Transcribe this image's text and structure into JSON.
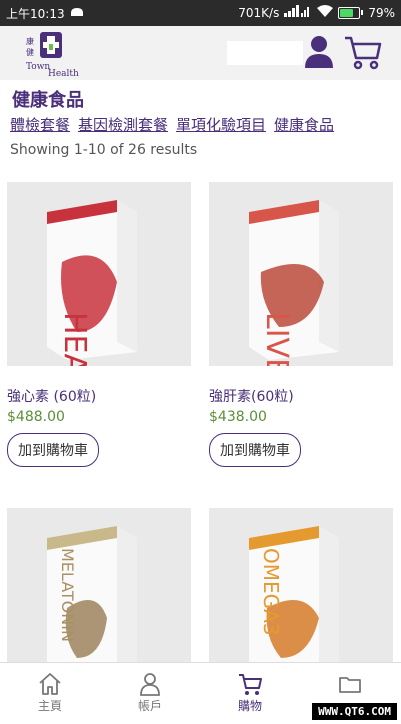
{
  "status_bar": {
    "time": "上午10:13",
    "network_speed": "701K/s",
    "battery_percent": "79%",
    "battery_level": 0.79
  },
  "header": {
    "logo_text_cn": "康健",
    "logo_text_en1": "Town",
    "logo_text_en2": "Health",
    "search_placeholder": ""
  },
  "page": {
    "title": "健康食品",
    "categories": [
      "體檢套餐",
      "基因檢測套餐",
      "單項化驗項目",
      "健康食品"
    ],
    "results_text": "Showing 1-10 of 26 results"
  },
  "products": [
    {
      "name": "強心素 (60粒)",
      "price": "$488.00",
      "button": "加到購物車",
      "box_text": "HEART",
      "color": "#c8323c"
    },
    {
      "name": "強肝素(60粒)",
      "price": "$438.00",
      "button": "加到購物車",
      "box_text": "LIVER",
      "color": "#d8554a"
    },
    {
      "name": "",
      "price": "",
      "button": "",
      "box_text": "MELATONIN",
      "color": "#c9b98a"
    },
    {
      "name": "",
      "price": "",
      "button": "",
      "box_text": "OMEGA3",
      "color": "#e59a2f"
    }
  ],
  "nav": {
    "home": "主頁",
    "account": "帳戶",
    "cart": "購物",
    "folder": ""
  },
  "colors": {
    "brand": "#4a2f7a",
    "price": "#5a8f3a"
  },
  "watermark": "WWW.QT6.COM"
}
